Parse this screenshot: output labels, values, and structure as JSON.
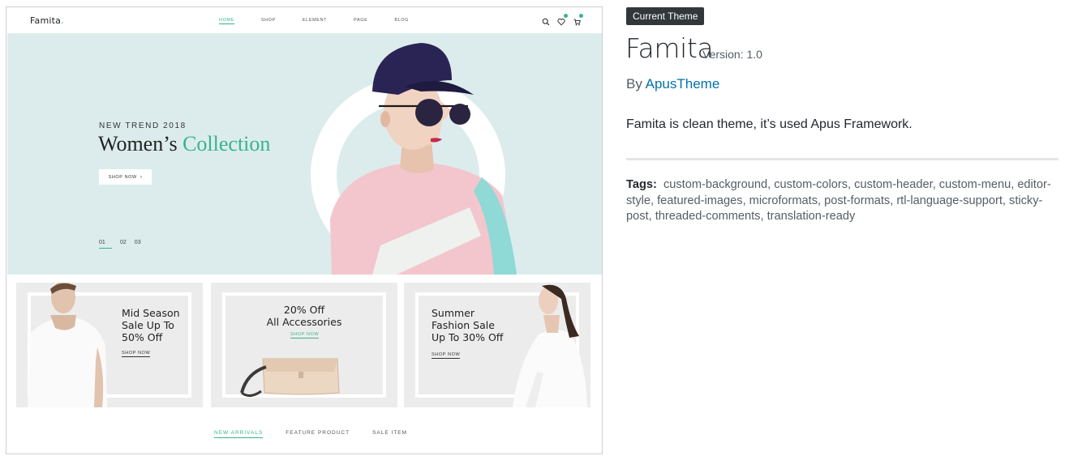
{
  "preview": {
    "logo": "Famita",
    "logo_dot": ".",
    "nav": [
      "HOME",
      "SHOP",
      "ELEMENT",
      "PAGE",
      "BLOG"
    ],
    "header_icons": [
      "search-icon",
      "heart-icon",
      "cart-icon"
    ],
    "hero": {
      "kicker": "NEW TREND 2018",
      "title_main": "Women’s",
      "title_accent": "Collection",
      "button": "SHOP NOW",
      "slides": [
        "01",
        "02",
        "03"
      ]
    },
    "banners": [
      {
        "text": "Mid Season\nSale Up To\n50% Off",
        "link": "SHOP NOW"
      },
      {
        "text": "20% Off\nAll Accessories",
        "link": "SHOP NOW"
      },
      {
        "text": "Summer\nFashion Sale\nUp To 30% Off",
        "link": "SHOP NOW"
      }
    ],
    "tabs": [
      "NEW ARRIVALS",
      "FEATURE PRODUCT",
      "SALE ITEM"
    ],
    "colors": {
      "accent": "#38b48b",
      "hero_bg": "#dceced",
      "banner_bg": "#ececec"
    }
  },
  "theme": {
    "current_label": "Current Theme",
    "name": "Famita",
    "version": "Version: 1.0",
    "by_prefix": "By",
    "author": "ApusTheme",
    "description": "Famita is clean theme, it’s used Apus Framework.",
    "tags_label": "Tags:",
    "tags": "custom-background, custom-colors, custom-header, custom-menu, editor-style, featured-images, microformats, post-formats, rtl-language-support, sticky-post, threaded-comments, translation-ready",
    "colors": {
      "link": "#0073aa",
      "label_bg": "#32373c"
    }
  }
}
